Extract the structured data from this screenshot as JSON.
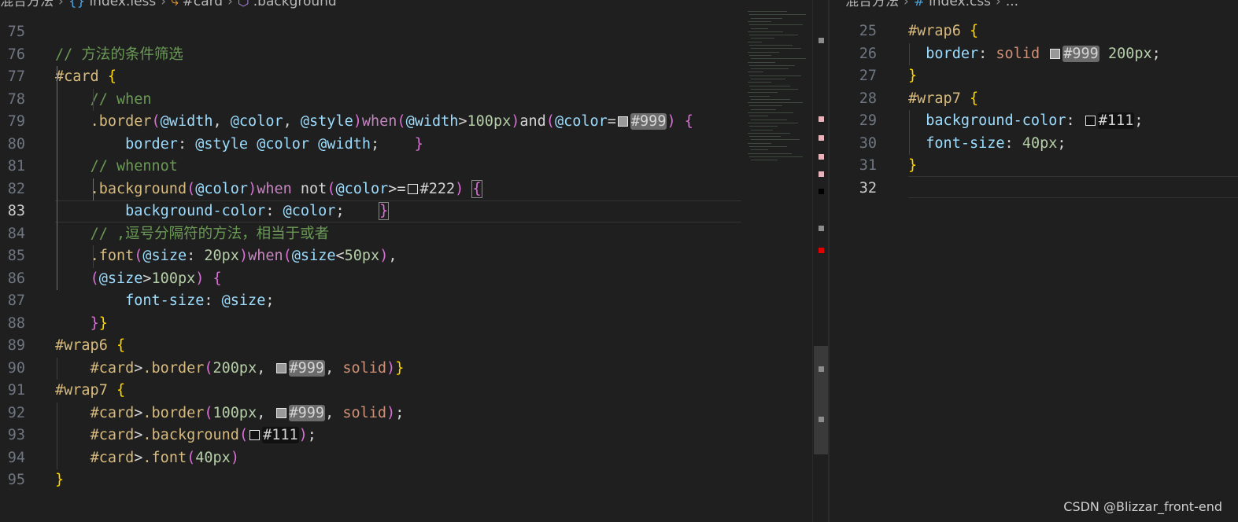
{
  "left_breadcrumb": {
    "items": [
      "混合方法",
      "index.less",
      "#card",
      ".background"
    ]
  },
  "right_breadcrumb": {
    "items": [
      "混合方法",
      "index.css",
      "..."
    ]
  },
  "left_editor": {
    "active_line": "83",
    "lines": [
      {
        "n": "75",
        "segs": []
      },
      {
        "n": "76",
        "segs": [
          {
            "c": "c-cm",
            "t": "// 方法的条件筛选"
          }
        ]
      },
      {
        "n": "77",
        "segs": [
          {
            "c": "c-sel",
            "t": "#card"
          },
          {
            "c": "c-col",
            "t": " "
          },
          {
            "c": "c-br1",
            "t": "{"
          }
        ]
      },
      {
        "n": "78",
        "segs": [
          {
            "c": "c-col",
            "t": "    "
          },
          {
            "c": "c-cm",
            "t": "// when"
          }
        ]
      },
      {
        "n": "79",
        "segs": [
          {
            "c": "c-col",
            "t": "    "
          },
          {
            "c": "c-sel",
            "t": ".border"
          },
          {
            "c": "c-br2",
            "t": "("
          },
          {
            "c": "c-var",
            "t": "@width"
          },
          {
            "c": "c-col",
            "t": ", "
          },
          {
            "c": "c-var",
            "t": "@color"
          },
          {
            "c": "c-col",
            "t": ", "
          },
          {
            "c": "c-var",
            "t": "@style"
          },
          {
            "c": "c-br2",
            "t": ")"
          },
          {
            "c": "c-kw",
            "t": "when"
          },
          {
            "c": "c-br2",
            "t": "("
          },
          {
            "c": "c-var",
            "t": "@width"
          },
          {
            "c": "c-col",
            "t": ">"
          },
          {
            "c": "c-num",
            "t": "100px"
          },
          {
            "c": "c-br2",
            "t": ")"
          },
          {
            "c": "c-col",
            "t": "and"
          },
          {
            "c": "c-br2",
            "t": "("
          },
          {
            "c": "c-var",
            "t": "@color"
          },
          {
            "c": "c-col",
            "t": "="
          },
          {
            "c": "sw",
            "t": "#999999"
          },
          {
            "c": "hl c-col",
            "t": "#999"
          },
          {
            "c": "c-br2",
            "t": ")"
          },
          {
            "c": "c-col",
            "t": " "
          },
          {
            "c": "c-br2",
            "t": "{"
          }
        ]
      },
      {
        "n": "80",
        "segs": [
          {
            "c": "c-col",
            "t": "        "
          },
          {
            "c": "c-prop",
            "t": "border"
          },
          {
            "c": "c-col",
            "t": ": "
          },
          {
            "c": "c-var",
            "t": "@style"
          },
          {
            "c": "c-col",
            "t": " "
          },
          {
            "c": "c-var",
            "t": "@color"
          },
          {
            "c": "c-col",
            "t": " "
          },
          {
            "c": "c-var",
            "t": "@width"
          },
          {
            "c": "c-col",
            "t": ";    "
          },
          {
            "c": "c-br2",
            "t": "}"
          }
        ]
      },
      {
        "n": "81",
        "segs": [
          {
            "c": "c-col",
            "t": "    "
          },
          {
            "c": "c-cm",
            "t": "// whennot"
          }
        ]
      },
      {
        "n": "82",
        "segs": [
          {
            "c": "c-col",
            "t": "    "
          },
          {
            "c": "c-sel",
            "t": ".background"
          },
          {
            "c": "c-br2",
            "t": "("
          },
          {
            "c": "c-var",
            "t": "@color"
          },
          {
            "c": "c-br2",
            "t": ")"
          },
          {
            "c": "c-kw",
            "t": "when"
          },
          {
            "c": "c-col",
            "t": " not"
          },
          {
            "c": "c-br2",
            "t": "("
          },
          {
            "c": "c-var",
            "t": "@color"
          },
          {
            "c": "c-col",
            "t": ">="
          },
          {
            "c": "sw",
            "t": "#222222"
          },
          {
            "c": "c-col",
            "t": "#222"
          },
          {
            "c": "c-br2",
            "t": ")"
          },
          {
            "c": "c-col",
            "t": " "
          },
          {
            "c": "c-br2 caretbox",
            "t": "{"
          }
        ]
      },
      {
        "n": "83",
        "segs": [
          {
            "c": "c-col",
            "t": "        "
          },
          {
            "c": "c-prop",
            "t": "background-color"
          },
          {
            "c": "c-col",
            "t": ": "
          },
          {
            "c": "c-var",
            "t": "@color"
          },
          {
            "c": "c-col",
            "t": ";    "
          },
          {
            "c": "c-br2 caretbox",
            "t": "}"
          }
        ]
      },
      {
        "n": "84",
        "segs": [
          {
            "c": "c-col",
            "t": "    "
          },
          {
            "c": "c-cm",
            "t": "// ,逗号分隔符的方法，相当于或者"
          }
        ]
      },
      {
        "n": "85",
        "segs": [
          {
            "c": "c-col",
            "t": "    "
          },
          {
            "c": "c-sel",
            "t": ".font"
          },
          {
            "c": "c-br2",
            "t": "("
          },
          {
            "c": "c-var",
            "t": "@size"
          },
          {
            "c": "c-col",
            "t": ": "
          },
          {
            "c": "c-num",
            "t": "20px"
          },
          {
            "c": "c-br2",
            "t": ")"
          },
          {
            "c": "c-kw",
            "t": "when"
          },
          {
            "c": "c-br2",
            "t": "("
          },
          {
            "c": "c-var",
            "t": "@size"
          },
          {
            "c": "c-col",
            "t": "<"
          },
          {
            "c": "c-num",
            "t": "50px"
          },
          {
            "c": "c-br2",
            "t": ")"
          },
          {
            "c": "c-col",
            "t": ","
          }
        ]
      },
      {
        "n": "86",
        "segs": [
          {
            "c": "c-col",
            "t": "    "
          },
          {
            "c": "c-br2",
            "t": "("
          },
          {
            "c": "c-var",
            "t": "@size"
          },
          {
            "c": "c-col",
            "t": ">"
          },
          {
            "c": "c-num",
            "t": "100px"
          },
          {
            "c": "c-br2",
            "t": ")"
          },
          {
            "c": "c-col",
            "t": " "
          },
          {
            "c": "c-br2",
            "t": "{"
          }
        ]
      },
      {
        "n": "87",
        "segs": [
          {
            "c": "c-col",
            "t": "        "
          },
          {
            "c": "c-prop",
            "t": "font-size"
          },
          {
            "c": "c-col",
            "t": ": "
          },
          {
            "c": "c-var",
            "t": "@size"
          },
          {
            "c": "c-col",
            "t": ";"
          }
        ]
      },
      {
        "n": "88",
        "segs": [
          {
            "c": "c-col",
            "t": "    "
          },
          {
            "c": "c-br2",
            "t": "}"
          },
          {
            "c": "c-br1",
            "t": "}"
          }
        ]
      },
      {
        "n": "89",
        "segs": [
          {
            "c": "c-sel",
            "t": "#wrap6"
          },
          {
            "c": "c-col",
            "t": " "
          },
          {
            "c": "c-br1",
            "t": "{"
          }
        ]
      },
      {
        "n": "90",
        "segs": [
          {
            "c": "c-col",
            "t": "    "
          },
          {
            "c": "c-sel",
            "t": "#card"
          },
          {
            "c": "c-col",
            "t": ">"
          },
          {
            "c": "c-sel",
            "t": ".border"
          },
          {
            "c": "c-br2",
            "t": "("
          },
          {
            "c": "c-num",
            "t": "200px"
          },
          {
            "c": "c-col",
            "t": ", "
          },
          {
            "c": "sw",
            "t": "#999999"
          },
          {
            "c": "hl c-col",
            "t": "#999"
          },
          {
            "c": "c-col",
            "t": ", "
          },
          {
            "c": "c-str",
            "t": "solid"
          },
          {
            "c": "c-br2",
            "t": ")"
          },
          {
            "c": "c-br1",
            "t": "}"
          }
        ]
      },
      {
        "n": "91",
        "segs": [
          {
            "c": "c-sel",
            "t": "#wrap7"
          },
          {
            "c": "c-col",
            "t": " "
          },
          {
            "c": "c-br1",
            "t": "{"
          }
        ]
      },
      {
        "n": "92",
        "segs": [
          {
            "c": "c-col",
            "t": "    "
          },
          {
            "c": "c-sel",
            "t": "#card"
          },
          {
            "c": "c-col",
            "t": ">"
          },
          {
            "c": "c-sel",
            "t": ".border"
          },
          {
            "c": "c-br2",
            "t": "("
          },
          {
            "c": "c-num",
            "t": "100px"
          },
          {
            "c": "c-col",
            "t": ", "
          },
          {
            "c": "sw",
            "t": "#999999"
          },
          {
            "c": "hl c-col",
            "t": "#999"
          },
          {
            "c": "c-col",
            "t": ", "
          },
          {
            "c": "c-str",
            "t": "solid"
          },
          {
            "c": "c-br2",
            "t": ")"
          },
          {
            "c": "c-col",
            "t": ";"
          }
        ]
      },
      {
        "n": "93",
        "segs": [
          {
            "c": "c-col",
            "t": "    "
          },
          {
            "c": "c-sel",
            "t": "#card"
          },
          {
            "c": "c-col",
            "t": ">"
          },
          {
            "c": "c-sel",
            "t": ".background"
          },
          {
            "c": "c-br2",
            "t": "("
          },
          {
            "c": "sw",
            "t": "#111111"
          },
          {
            "c": "hl-dark c-col",
            "t": "#111"
          },
          {
            "c": "c-br2",
            "t": ")"
          },
          {
            "c": "c-col",
            "t": ";"
          }
        ]
      },
      {
        "n": "94",
        "segs": [
          {
            "c": "c-col",
            "t": "    "
          },
          {
            "c": "c-sel",
            "t": "#card"
          },
          {
            "c": "c-col",
            "t": ">"
          },
          {
            "c": "c-sel",
            "t": ".font"
          },
          {
            "c": "c-br2",
            "t": "("
          },
          {
            "c": "c-num",
            "t": "40px"
          },
          {
            "c": "c-br2",
            "t": ")"
          }
        ]
      },
      {
        "n": "95",
        "segs": [
          {
            "c": "c-br1",
            "t": "}"
          }
        ]
      }
    ]
  },
  "right_editor": {
    "active_line": "32",
    "lines": [
      {
        "n": "25",
        "segs": [
          {
            "c": "c-sel",
            "t": "#wrap6"
          },
          {
            "c": "c-col",
            "t": " "
          },
          {
            "c": "c-br1",
            "t": "{"
          }
        ]
      },
      {
        "n": "26",
        "segs": [
          {
            "c": "c-col",
            "t": "  "
          },
          {
            "c": "c-prop",
            "t": "border"
          },
          {
            "c": "c-col",
            "t": ": "
          },
          {
            "c": "c-val",
            "t": "solid"
          },
          {
            "c": "c-col",
            "t": " "
          },
          {
            "c": "sw",
            "t": "#999999"
          },
          {
            "c": "hl c-col",
            "t": "#999"
          },
          {
            "c": "c-col",
            "t": " "
          },
          {
            "c": "c-num",
            "t": "200px"
          },
          {
            "c": "c-col",
            "t": ";"
          }
        ]
      },
      {
        "n": "27",
        "segs": [
          {
            "c": "c-br1",
            "t": "}"
          }
        ]
      },
      {
        "n": "28",
        "segs": [
          {
            "c": "c-sel",
            "t": "#wrap7"
          },
          {
            "c": "c-col",
            "t": " "
          },
          {
            "c": "c-br1",
            "t": "{"
          }
        ]
      },
      {
        "n": "29",
        "segs": [
          {
            "c": "c-col",
            "t": "  "
          },
          {
            "c": "c-prop",
            "t": "background-color"
          },
          {
            "c": "c-col",
            "t": ": "
          },
          {
            "c": "sw",
            "t": "#111111"
          },
          {
            "c": "hl-dark c-col",
            "t": "#111"
          },
          {
            "c": "c-col",
            "t": ";"
          }
        ]
      },
      {
        "n": "30",
        "segs": [
          {
            "c": "c-col",
            "t": "  "
          },
          {
            "c": "c-prop",
            "t": "font-size"
          },
          {
            "c": "c-col",
            "t": ": "
          },
          {
            "c": "c-num",
            "t": "40px"
          },
          {
            "c": "c-col",
            "t": ";"
          }
        ]
      },
      {
        "n": "31",
        "segs": [
          {
            "c": "c-br1",
            "t": "}"
          }
        ]
      },
      {
        "n": "32",
        "segs": []
      }
    ]
  },
  "scrollbar_markers": [
    {
      "color": "#8c8c8c"
    },
    {
      "color": "#e8b4bc"
    },
    {
      "color": "#e8b4bc"
    },
    {
      "color": "#e8b4bc"
    },
    {
      "color": "#e8b4bc"
    },
    {
      "color": "#000000"
    },
    {
      "color": "#8c8c8c"
    },
    {
      "color": "#e00000"
    },
    {
      "color": "#8c8c8c"
    },
    {
      "color": "#8c8c8c"
    }
  ],
  "watermark": "CSDN @Blizzar_front-end"
}
